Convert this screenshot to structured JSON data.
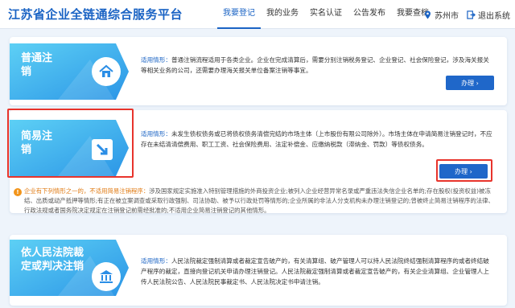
{
  "header": {
    "site_title": "江苏省企业全链通综合服务平台",
    "nav": [
      "我要登记",
      "我的业务",
      "实名认证",
      "公告发布",
      "我要查档"
    ],
    "city": "苏州市",
    "logout": "退出系统"
  },
  "cards": [
    {
      "badge": "普通注\n销",
      "tag": "适用情形：",
      "desc": "普通注销流程适用于各类企业。企业在完成清算后，需要分别注销税务登记、企业登记、社会保险登记，涉及海关报关等相关业务的公司，还需要办理海关报关单位备案注销等事宜。",
      "button": "办理 ›",
      "icon": "house-icon"
    },
    {
      "badge": "简易注\n销",
      "tag": "适用情形：",
      "desc": "未发生债权债务或已将债权债务清偿完结的市场主体（上市股份有限公司除外）。市场主体在申请简易注销登记时，不应存在未结清清偿费用、职工工资、社会保险费用、法定补偿金、应缴纳税款（滞纳金、罚款）等债权债务。",
      "button": "办理 ›",
      "icon": "arrow-icon"
    },
    {
      "badge": "依人民法院裁\n定或判决注销",
      "tag": "适用情形：",
      "desc": "人民法院裁定强制清算或者裁定宣告破产的，有关清算组、破产管理人可以持人民法院终结强制清算程序的或者终结破产程序的裁定，直接向登记机关申请办理注销登记。人民法院裁定强制清算或者裁定宣告破产的，有关企业清算组、企业管理人上传人民法院公告、人民法院民事裁定书、人民法院决定书申请注销。",
      "button": "办理 ›",
      "icon": "bank-icon"
    }
  ],
  "warning": {
    "lead": "企业有下列情形之一的，不适用简易注销程序：",
    "text": "涉及国家规定实施准入特别管理措施的外商投资企业;被列入企业经营异常名录或严重违法失信企业名单的;存在股权(投资权益)被冻结、出质或动产抵押等情形;有正在被立案调查或采取行政强制、司法协助、被予以行政处罚等情形的;企业所属的非法人分支机构未办理注销登记的;曾被终止简易注销程序的法律、行政法规或者国务院决定规定在注销登记前需经批准的;不适用企业简易注销登记的其他情形。"
  },
  "colors": {
    "primary": "#1f67c9",
    "badge_start": "#3ec3ee",
    "badge_end": "#1c8ae0",
    "warning": "#e07b14",
    "highlight": "#e8342c"
  }
}
